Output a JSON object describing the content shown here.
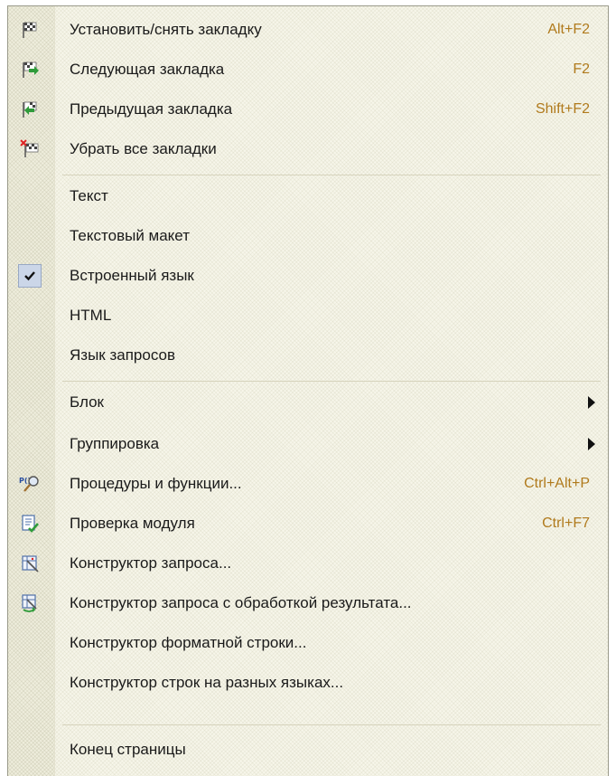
{
  "menu": {
    "items": [
      {
        "label": "Установить/снять закладку",
        "shortcut": "Alt+F2",
        "icon": "bookmark-flag-icon"
      },
      {
        "label": "Следующая закладка",
        "shortcut": "F2",
        "icon": "next-bookmark-icon"
      },
      {
        "label": "Предыдущая закладка",
        "shortcut": "Shift+F2",
        "icon": "previous-bookmark-icon"
      },
      {
        "label": "Убрать все закладки",
        "shortcut": "",
        "icon": "remove-bookmarks-icon"
      },
      {
        "label": "Текст",
        "shortcut": ""
      },
      {
        "label": "Текстовый макет",
        "shortcut": ""
      },
      {
        "label": "Встроенный язык",
        "shortcut": "",
        "checked": true
      },
      {
        "label": "HTML",
        "shortcut": ""
      },
      {
        "label": "Язык запросов",
        "shortcut": ""
      },
      {
        "label": "Блок",
        "shortcut": "",
        "submenu": true
      },
      {
        "label": "Группировка",
        "shortcut": "",
        "submenu": true
      },
      {
        "label": "Процедуры и функции...",
        "shortcut": "Ctrl+Alt+P",
        "icon": "procedures-search-icon"
      },
      {
        "label": "Проверка модуля",
        "shortcut": "Ctrl+F7",
        "icon": "module-check-icon"
      },
      {
        "label": "Конструктор запроса...",
        "shortcut": "",
        "icon": "query-wizard-icon"
      },
      {
        "label": "Конструктор запроса с обработкой результата...",
        "shortcut": "",
        "icon": "query-wizard-result-icon"
      },
      {
        "label": "Конструктор форматной строки...",
        "shortcut": ""
      },
      {
        "label": "Конструктор строк на разных языках...",
        "shortcut": ""
      },
      {
        "label": "Конец страницы",
        "shortcut": ""
      }
    ]
  },
  "colors": {
    "shortcut": "#b07a1c",
    "check_bg": "#cbd6e8"
  }
}
